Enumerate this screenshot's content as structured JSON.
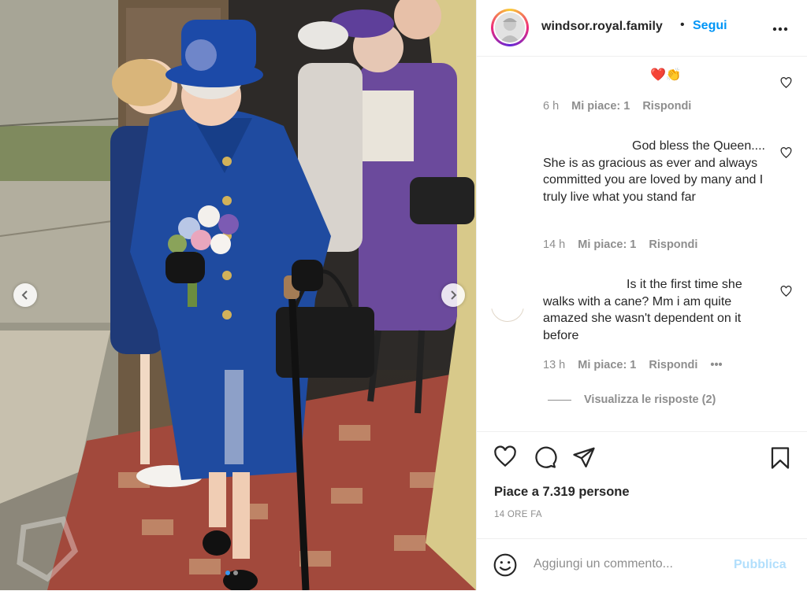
{
  "post": {
    "username": "windsor.royal.family",
    "separator": "•",
    "follow_label": "Segui",
    "more_icon": "more-horizontal-icon"
  },
  "comments": [
    {
      "text": "❤️👏",
      "time": "6 h",
      "likes": "Mi piace: 1",
      "reply": "Rispondi"
    },
    {
      "text": "God bless the Queen.... She is as gracious as ever and always committed you are loved by many and I truly live what you stand far",
      "time": "14 h",
      "likes": "Mi piace: 1",
      "reply": "Rispondi"
    },
    {
      "text": "Is it the first time she walks with a cane? Mm i am quite amazed she wasn't dependent on it before",
      "time": "13 h",
      "likes": "Mi piace: 1",
      "reply": "Rispondi",
      "more": "•••",
      "view_replies": "Visualizza le risposte (2)"
    }
  ],
  "actions": {
    "likes_count": "Piace a 7.319 persone",
    "timestamp": "14 ORE FA"
  },
  "composer": {
    "placeholder": "Aggiungi un commento...",
    "publish_label": "Pubblica"
  },
  "carousel": {
    "slides": 2,
    "active": 1
  },
  "colors": {
    "accent": "#0095f6",
    "publish_disabled": "#b2dffc",
    "muted": "#8e8e8e",
    "text": "#262626"
  }
}
